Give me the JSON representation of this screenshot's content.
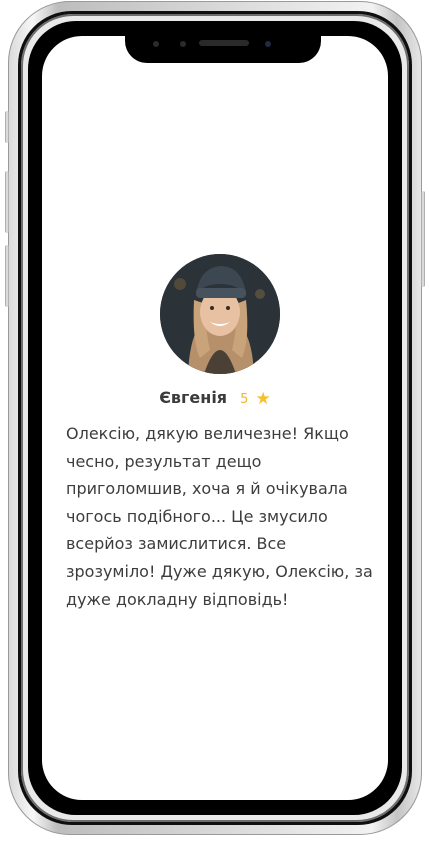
{
  "review": {
    "name": "Євгенія",
    "rating": "5",
    "star_icon": "star-icon",
    "text": "Олексію, дякую величезне! Якщо чесно, результат дещо приголомшив, хоча я й очікувала чогось подібного... Це змусило всерйоз замислитися. Все зрозуміло! Дуже дякую, Олексію, за дуже докладну відповідь!"
  },
  "colors": {
    "star": "#f6c12f",
    "text": "#3d3d3d",
    "name": "#3b3b3b"
  }
}
